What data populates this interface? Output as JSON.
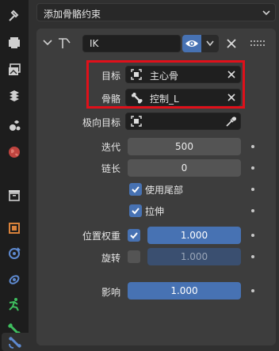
{
  "header": {
    "add_constraint_label": "添加骨骼约束"
  },
  "constraint": {
    "name": "IK",
    "target": {
      "label": "目标",
      "value": "主心骨"
    },
    "bone": {
      "label": "骨骼",
      "value": "控制_L"
    },
    "pole_target": {
      "label": "极向目标",
      "value": ""
    },
    "iterations": {
      "label": "迭代",
      "value": "500"
    },
    "chain_length": {
      "label": "链长",
      "value": "0"
    },
    "use_tail": {
      "label": "使用尾部",
      "checked": true
    },
    "stretch": {
      "label": "拉伸",
      "checked": true
    },
    "position_weight": {
      "label": "位置权重",
      "checked": true,
      "value": "1.000"
    },
    "rotation": {
      "label": "旋转",
      "checked": false,
      "value": "1.000"
    },
    "influence": {
      "label": "影响",
      "value": "1.000"
    }
  },
  "colors": {
    "accent": "#4772b3",
    "highlight_border": "#e0101a",
    "panel": "#3d3d3d",
    "background": "#303030"
  },
  "sidebar": {
    "tabs": [
      "tool-icon",
      "render-icon",
      "output-icon",
      "view-layer-icon",
      "scene-icon",
      "world-icon",
      "collection-icon",
      "object-icon",
      "modifiers-icon",
      "particles-icon",
      "physics-icon",
      "object-constraint-icon",
      "object-data-icon",
      "bone-icon",
      "bone-constraint-icon"
    ],
    "active": "bone-constraint-icon"
  }
}
